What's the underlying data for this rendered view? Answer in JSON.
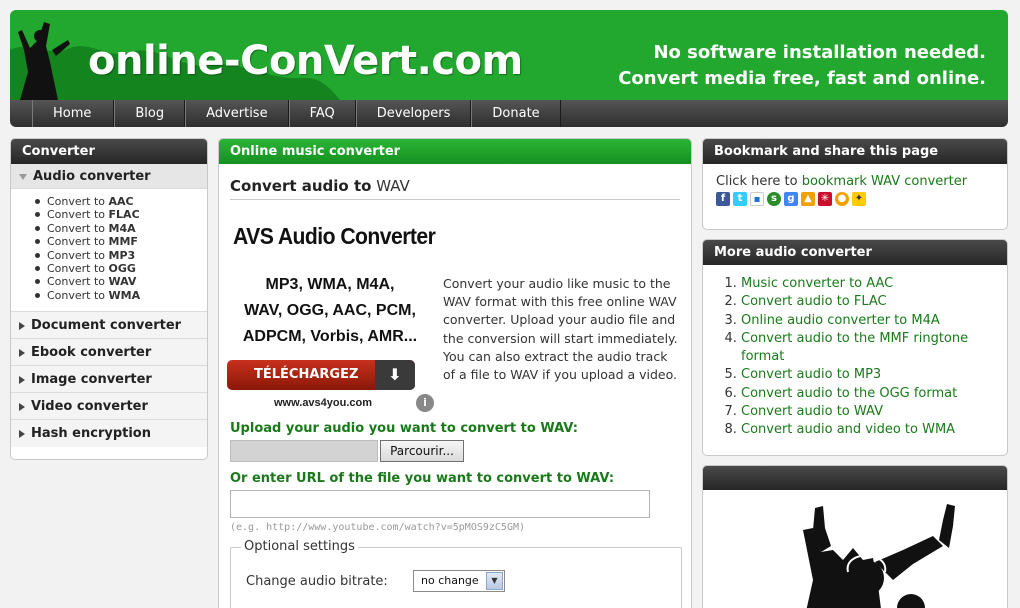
{
  "header": {
    "logo": "online-ConVert.com",
    "tagline_line1": "No software installation needed.",
    "tagline_line2": "Convert media free, fast and online."
  },
  "nav": [
    "Home",
    "Blog",
    "Advertise",
    "FAQ",
    "Developers",
    "Donate"
  ],
  "sidebar": {
    "title": "Converter",
    "open_section": "Audio converter",
    "audio_items": [
      {
        "prefix": "Convert to ",
        "format": "AAC"
      },
      {
        "prefix": "Convert to ",
        "format": "FLAC"
      },
      {
        "prefix": "Convert to ",
        "format": "M4A"
      },
      {
        "prefix": "Convert to ",
        "format": "MMF"
      },
      {
        "prefix": "Convert to ",
        "format": "MP3"
      },
      {
        "prefix": "Convert to ",
        "format": "OGG"
      },
      {
        "prefix": "Convert to ",
        "format": "WAV"
      },
      {
        "prefix": "Convert to ",
        "format": "WMA"
      }
    ],
    "sections": [
      "Document converter",
      "Ebook converter",
      "Image converter",
      "Video converter",
      "Hash encryption"
    ]
  },
  "main": {
    "title": "Online music converter",
    "heading_prefix": "Convert audio to",
    "heading_format": " WAV",
    "ad": {
      "title": "AVS Audio Converter",
      "formats_line1": "MP3, WMA, M4A,",
      "formats_line2": "WAV, OGG, AAC, PCM,",
      "formats_line3": "ADPCM, Vorbis, AMR...",
      "button": "TÉLÉCHARGEZ",
      "url": "www.avs4you.com"
    },
    "description": "Convert your audio like music to the WAV format with this free online WAV converter. Upload your audio file and the conversion will start immediately. You can also extract the audio track of a file to WAV if you upload a video.",
    "upload_label": "Upload your audio you want to convert to WAV:",
    "browse_button": "Parcourir...",
    "url_label": "Or enter URL of the file you want to convert to WAV:",
    "url_example": "(e.g. http://www.youtube.com/watch?v=5pMOS9zC5GM)",
    "optional_settings": "Optional settings",
    "bitrate_label": "Change audio bitrate:",
    "bitrate_value": "no change"
  },
  "bookmark": {
    "title": "Bookmark and share this page",
    "text": "Click here to ",
    "link": "bookmark WAV converter"
  },
  "more": {
    "title": "More audio converter",
    "items": [
      "Music converter to AAC",
      "Convert audio to FLAC",
      "Online audio converter to M4A",
      "Convert audio to the MMF ringtone format",
      "Convert audio to MP3",
      "Convert audio to the OGG format",
      "Convert audio to WAV",
      "Convert audio and video to WMA"
    ]
  },
  "colors": {
    "brand_green": "#22a82e",
    "link_green": "#1a7a1a",
    "dark_bar": "#2e2e2e"
  }
}
